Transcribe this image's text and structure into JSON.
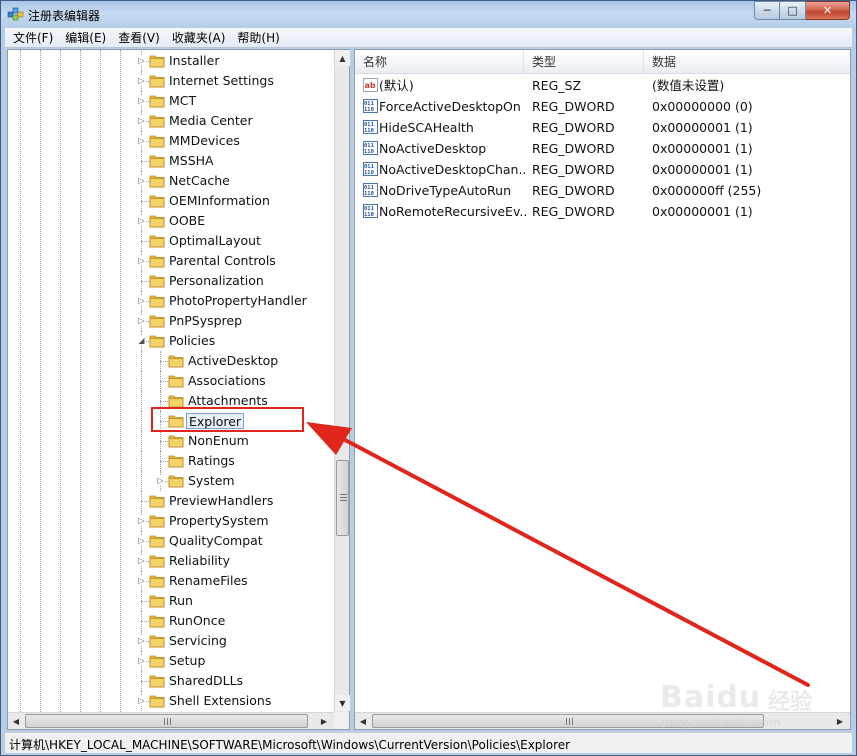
{
  "window": {
    "title": "注册表编辑器",
    "controls": {
      "minimize": "─",
      "maximize": "□",
      "close": "✕"
    }
  },
  "menu": [
    "文件(F)",
    "编辑(E)",
    "查看(V)",
    "收藏夹(A)",
    "帮助(H)"
  ],
  "tree": {
    "items": [
      {
        "label": "Installer",
        "level": 1,
        "expander": "▷"
      },
      {
        "label": "Internet Settings",
        "level": 1,
        "expander": "▷"
      },
      {
        "label": "MCT",
        "level": 1,
        "expander": "▷"
      },
      {
        "label": "Media Center",
        "level": 1,
        "expander": "▷"
      },
      {
        "label": "MMDevices",
        "level": 1,
        "expander": "▷"
      },
      {
        "label": "MSSHA",
        "level": 1,
        "expander": ""
      },
      {
        "label": "NetCache",
        "level": 1,
        "expander": "▷"
      },
      {
        "label": "OEMInformation",
        "level": 1,
        "expander": ""
      },
      {
        "label": "OOBE",
        "level": 1,
        "expander": "▷"
      },
      {
        "label": "OptimalLayout",
        "level": 1,
        "expander": ""
      },
      {
        "label": "Parental Controls",
        "level": 1,
        "expander": "▷"
      },
      {
        "label": "Personalization",
        "level": 1,
        "expander": ""
      },
      {
        "label": "PhotoPropertyHandler",
        "level": 1,
        "expander": "▷"
      },
      {
        "label": "PnPSysprep",
        "level": 1,
        "expander": "▷"
      },
      {
        "label": "Policies",
        "level": 1,
        "expander": "◢"
      },
      {
        "label": "ActiveDesktop",
        "level": 2,
        "expander": ""
      },
      {
        "label": "Associations",
        "level": 2,
        "expander": ""
      },
      {
        "label": "Attachments",
        "level": 2,
        "expander": ""
      },
      {
        "label": "Explorer",
        "level": 2,
        "expander": "",
        "selected": true
      },
      {
        "label": "NonEnum",
        "level": 2,
        "expander": ""
      },
      {
        "label": "Ratings",
        "level": 2,
        "expander": ""
      },
      {
        "label": "System",
        "level": 2,
        "expander": "▷"
      },
      {
        "label": "PreviewHandlers",
        "level": 1,
        "expander": ""
      },
      {
        "label": "PropertySystem",
        "level": 1,
        "expander": "▷"
      },
      {
        "label": "QualityCompat",
        "level": 1,
        "expander": "▷"
      },
      {
        "label": "Reliability",
        "level": 1,
        "expander": "▷"
      },
      {
        "label": "RenameFiles",
        "level": 1,
        "expander": "▷"
      },
      {
        "label": "Run",
        "level": 1,
        "expander": ""
      },
      {
        "label": "RunOnce",
        "level": 1,
        "expander": ""
      },
      {
        "label": "Servicing",
        "level": 1,
        "expander": "▷"
      },
      {
        "label": "Setup",
        "level": 1,
        "expander": "▷"
      },
      {
        "label": "SharedDLLs",
        "level": 1,
        "expander": ""
      },
      {
        "label": "Shell Extensions",
        "level": 1,
        "expander": "▷"
      }
    ]
  },
  "values": {
    "columns": [
      "名称",
      "类型",
      "数据"
    ],
    "rows": [
      {
        "icon": "string-value-icon",
        "name": "(默认)",
        "type": "REG_SZ",
        "data": "(数值未设置)"
      },
      {
        "icon": "binary-value-icon",
        "name": "ForceActiveDesktopOn",
        "type": "REG_DWORD",
        "data": "0x00000000 (0)"
      },
      {
        "icon": "binary-value-icon",
        "name": "HideSCAHealth",
        "type": "REG_DWORD",
        "data": "0x00000001 (1)"
      },
      {
        "icon": "binary-value-icon",
        "name": "NoActiveDesktop",
        "type": "REG_DWORD",
        "data": "0x00000001 (1)"
      },
      {
        "icon": "binary-value-icon",
        "name": "NoActiveDesktopChan...",
        "type": "REG_DWORD",
        "data": "0x00000001 (1)"
      },
      {
        "icon": "binary-value-icon",
        "name": "NoDriveTypeAutoRun",
        "type": "REG_DWORD",
        "data": "0x000000ff (255)"
      },
      {
        "icon": "binary-value-icon",
        "name": "NoRemoteRecursiveEv...",
        "type": "REG_DWORD",
        "data": "0x00000001 (1)"
      }
    ]
  },
  "status": {
    "path": "计算机\\HKEY_LOCAL_MACHINE\\SOFTWARE\\Microsoft\\Windows\\CurrentVersion\\Policies\\Explorer"
  },
  "watermark": {
    "logo": "Baidu",
    "cn": "经验",
    "url": "jingyan.baidu.com"
  },
  "colors": {
    "annotation": "#e0261c",
    "folder": "#f2c34b",
    "selection_border": "#7da2ce"
  }
}
